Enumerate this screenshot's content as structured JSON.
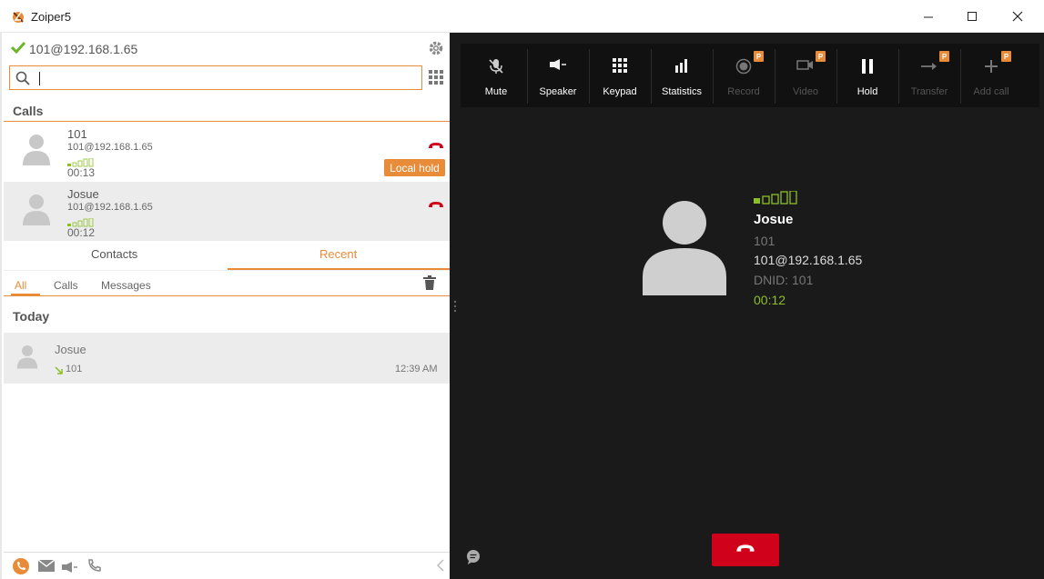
{
  "window": {
    "title": "Zoiper5"
  },
  "account": {
    "status_icon": "check-icon",
    "address": "101@192.168.1.65"
  },
  "search": {
    "value": "",
    "placeholder": ""
  },
  "calls": {
    "heading": "Calls",
    "items": [
      {
        "name": "101",
        "address": "101@192.168.1.65",
        "duration": "00:13",
        "badge": "Local hold"
      },
      {
        "name": "Josue",
        "address": "101@192.168.1.65",
        "duration": "00:12"
      }
    ]
  },
  "tabs": {
    "contacts": "Contacts",
    "recent": "Recent",
    "active": "recent"
  },
  "filters": {
    "all": "All",
    "calls": "Calls",
    "messages": "Messages",
    "active": "all"
  },
  "recent": {
    "group": "Today",
    "items": [
      {
        "name": "Josue",
        "number": "101",
        "time": "12:39 AM",
        "direction": "incoming"
      }
    ]
  },
  "toolbar": {
    "buttons": [
      {
        "label": "Mute",
        "icon": "mic-off-icon",
        "enabled": true,
        "pro": false
      },
      {
        "label": "Speaker",
        "icon": "speaker-icon",
        "enabled": true,
        "pro": false
      },
      {
        "label": "Keypad",
        "icon": "keypad-icon",
        "enabled": true,
        "pro": false
      },
      {
        "label": "Statistics",
        "icon": "statistics-icon",
        "enabled": true,
        "pro": false
      },
      {
        "label": "Record",
        "icon": "record-icon",
        "enabled": false,
        "pro": true
      },
      {
        "label": "Video",
        "icon": "video-icon",
        "enabled": false,
        "pro": true
      },
      {
        "label": "Hold",
        "icon": "pause-icon",
        "enabled": true,
        "pro": false
      },
      {
        "label": "Transfer",
        "icon": "transfer-icon",
        "enabled": false,
        "pro": true
      },
      {
        "label": "Add call",
        "icon": "add-icon",
        "enabled": false,
        "pro": true
      }
    ],
    "pro_badge": "P"
  },
  "active_call": {
    "name": "Josue",
    "number": "101",
    "address": "101@192.168.1.65",
    "dnid": "DNID: 101",
    "duration": "00:12"
  },
  "colors": {
    "accent": "#e98c3a",
    "signal": "#8cbf26",
    "hangup": "#d0021b",
    "call_panel_bg": "#1a1a1a",
    "toolbar_bg": "#111111"
  }
}
